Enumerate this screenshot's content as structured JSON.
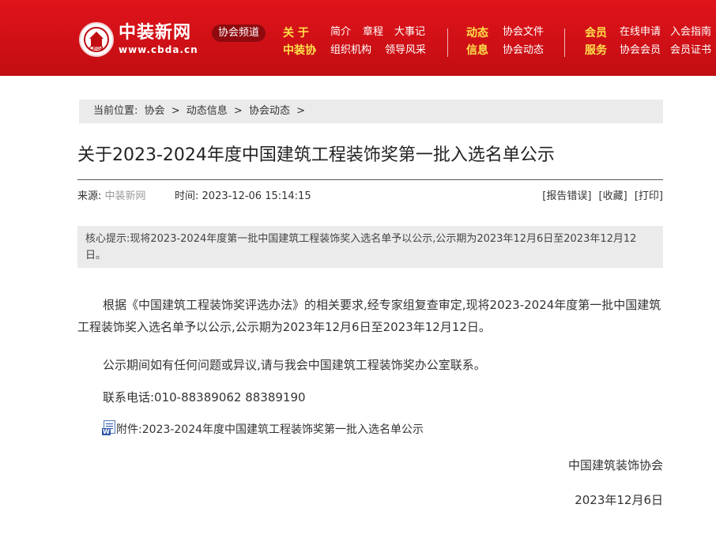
{
  "header": {
    "logo": {
      "name": "中装新网",
      "url": "www.cbda.cn",
      "seal_text": "CBDA"
    },
    "channel": "协会频道",
    "nav": {
      "about": {
        "head_top": "关 于",
        "head_bottom": "中装协",
        "links_top": [
          "简介",
          "章程",
          "大事记"
        ],
        "links_bottom": [
          "组织机构",
          "领导风采"
        ]
      },
      "news": {
        "head_top": "动态",
        "head_bottom": "信息",
        "links_top": [
          "协会文件"
        ],
        "links_bottom": [
          "协会动态"
        ]
      },
      "member": {
        "head_top": "会员",
        "head_bottom": "服务",
        "links_top": [
          "在线申请",
          "入会指南"
        ],
        "links_bottom": [
          "协会会员",
          "会员证书"
        ]
      }
    }
  },
  "breadcrumb": {
    "label": "当前位置:",
    "items": [
      "协会",
      "动态信息",
      "协会动态"
    ],
    "separator": ">"
  },
  "article": {
    "title": "关于2023-2024年度中国建筑工程装饰奖第一批入选名单公示",
    "source_label": "来源:",
    "source_name": "中装新网",
    "time_label": "时间:",
    "time": "2023-12-06 15:14:15",
    "tools": [
      "[报告错误]",
      "[收藏]",
      "[打印]"
    ],
    "summary": "核心提示:现将2023-2024年度第一批中国建筑工程装饰奖入选名单予以公示,公示期为2023年12月6日至2023年12月12日。",
    "paragraphs": [
      "根据《中国建筑工程装饰奖评选办法》的相关要求,经专家组复查审定,现将2023-2024年度第一批中国建筑工程装饰奖入选名单予以公示,公示期为2023年12月6日至2023年12月12日。",
      "公示期间如有任何问题或异议,请与我会中国建筑工程装饰奖办公室联系。",
      "联系电话:010-88389062  88389190"
    ],
    "attachment": "附件:2023-2024年度中国建筑工程装饰奖第一批入选名单公示",
    "signature": "中国建筑装饰协会",
    "date": "2023年12月6日"
  },
  "colors": {
    "header_red": "#c10d12",
    "nav_accent": "#ffe14a",
    "gray_bar": "#ebebeb"
  }
}
